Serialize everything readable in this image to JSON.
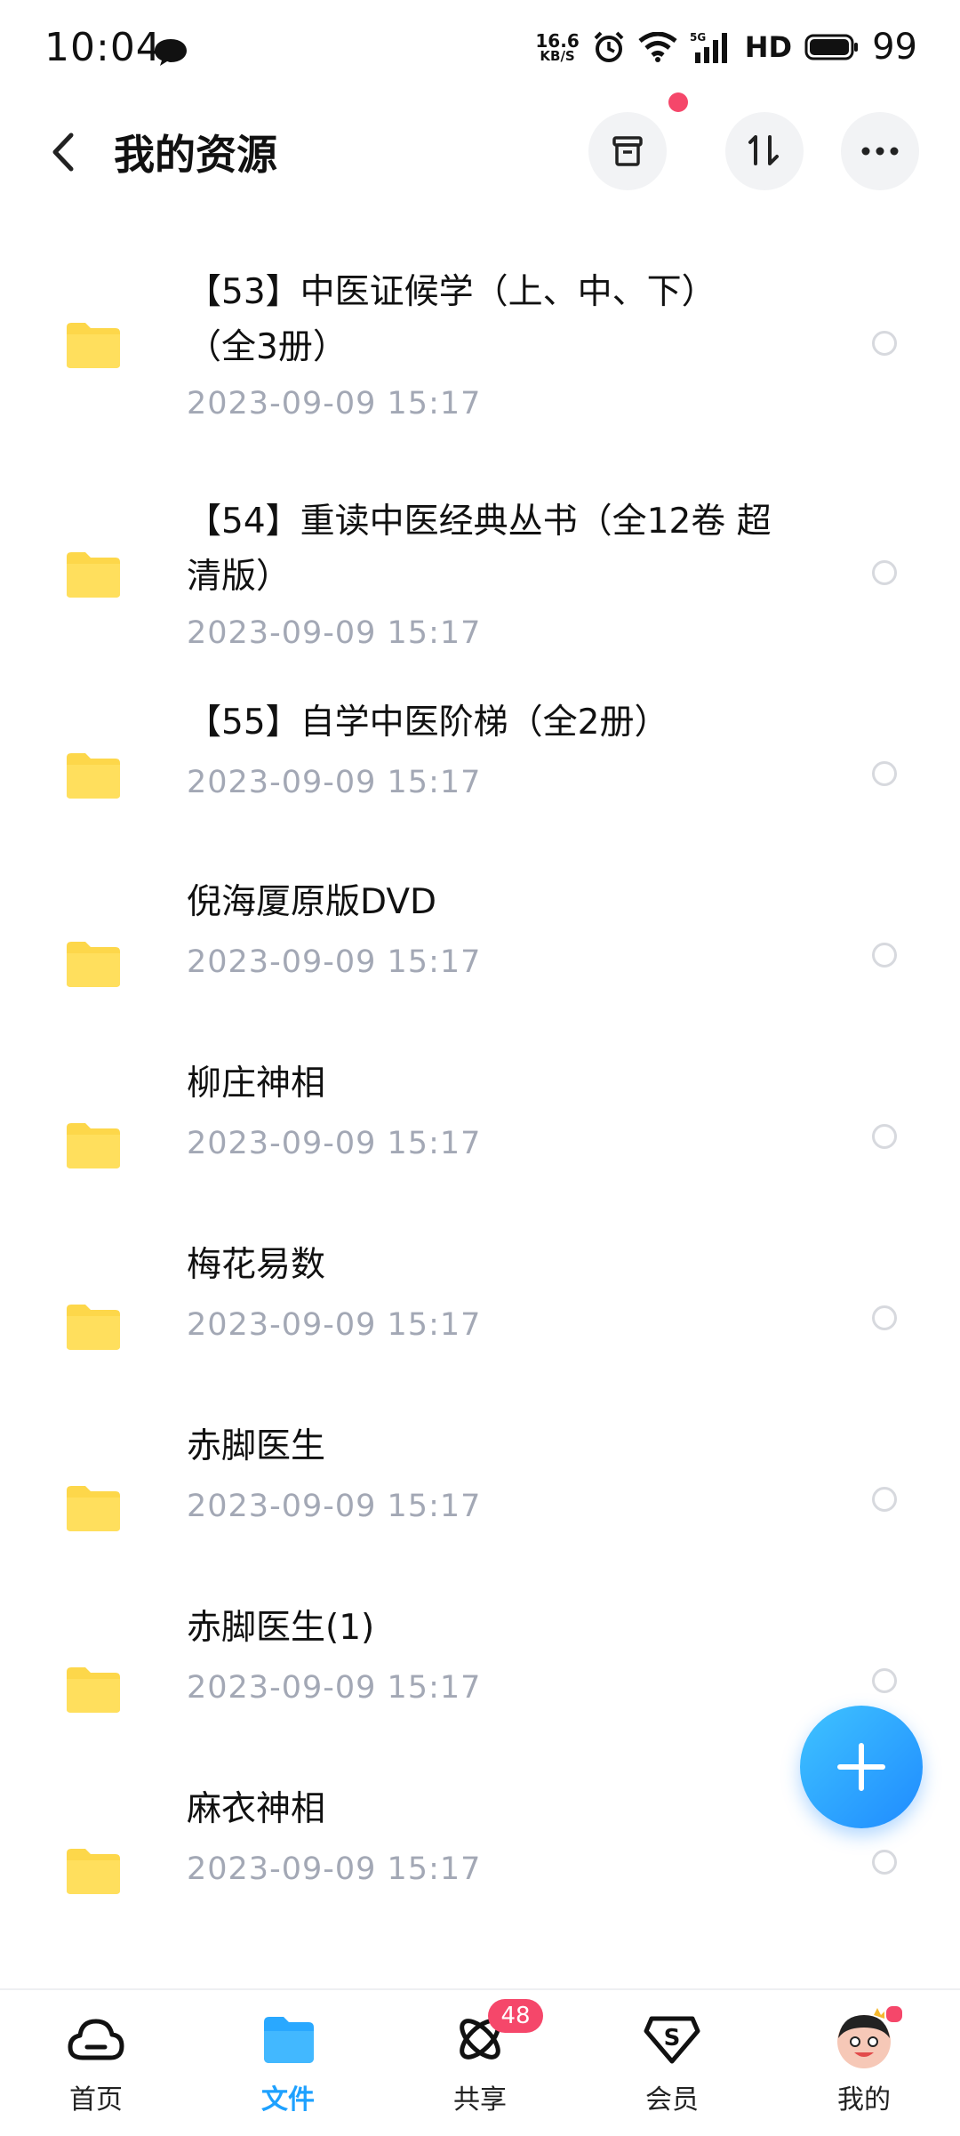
{
  "status_bar": {
    "time": "10:04",
    "net_speed_value": "16.6",
    "net_speed_unit": "KB/S",
    "network": "5G",
    "hd": "HD",
    "battery": "99"
  },
  "header": {
    "title": "我的资源"
  },
  "files": [
    {
      "name_line1": "【53】中医证候学（上、中、下）",
      "name_line2": "（全3册）",
      "date": "2023-09-09  15:17"
    },
    {
      "name_line1": "【54】重读中医经典丛书（全12卷 超",
      "name_line2": "清版）",
      "date": "2023-09-09  15:17"
    },
    {
      "name_line1": "【55】自学中医阶梯（全2册）",
      "name_line2": "",
      "date": "2023-09-09  15:17"
    },
    {
      "name_line1": "倪海厦原版DVD",
      "name_line2": "",
      "date": "2023-09-09  15:17"
    },
    {
      "name_line1": "柳庄神相",
      "name_line2": "",
      "date": "2023-09-09  15:17"
    },
    {
      "name_line1": "梅花易数",
      "name_line2": "",
      "date": "2023-09-09  15:17"
    },
    {
      "name_line1": "赤脚医生",
      "name_line2": "",
      "date": "2023-09-09  15:17"
    },
    {
      "name_line1": "赤脚医生(1)",
      "name_line2": "",
      "date": "2023-09-09  15:17"
    },
    {
      "name_line1": "麻衣神相",
      "name_line2": "",
      "date": "2023-09-09  15:17"
    }
  ],
  "nav": {
    "home": "首页",
    "files": "文件",
    "share": "共享",
    "share_badge": "48",
    "member": "会员",
    "mine": "我的"
  },
  "colors": {
    "accent": "#1ea1ff",
    "folder": "#fdd74a",
    "badge": "#f5476a",
    "date_text": "#a3a8b5"
  },
  "icons": {
    "back": "chevron-left-icon",
    "archive": "archive-icon",
    "sort": "sort-icon",
    "more": "more-icon",
    "add": "plus-icon"
  }
}
